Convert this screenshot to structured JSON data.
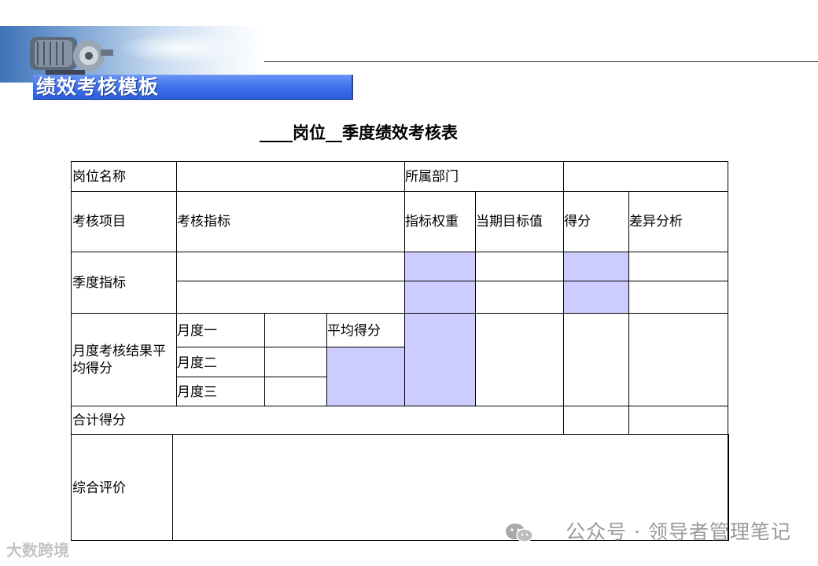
{
  "header": {
    "template_title": "绩效考核模板"
  },
  "document": {
    "title": "____岗位__季度绩效考核表"
  },
  "table": {
    "position_name_label": "岗位名称",
    "department_label": "所属部门",
    "columns": {
      "item": "考核项目",
      "indicator": "考核指标",
      "weight": "指标权重",
      "target": "当期目标值",
      "score": "得分",
      "variance": "差异分析"
    },
    "quarterly_indicator": "季度指标",
    "monthly_avg_label": "月度考核结果平均得分",
    "months": [
      "月度一",
      "月度二",
      "月度三"
    ],
    "average_score": "平均得分",
    "total_score": "合计得分",
    "overall_evaluation": "综合评价",
    "shade_color": "#ccccff"
  },
  "watermark": {
    "text": "公众号 · 领导者管理笔记"
  },
  "logo": {
    "text": "大数跨境"
  }
}
